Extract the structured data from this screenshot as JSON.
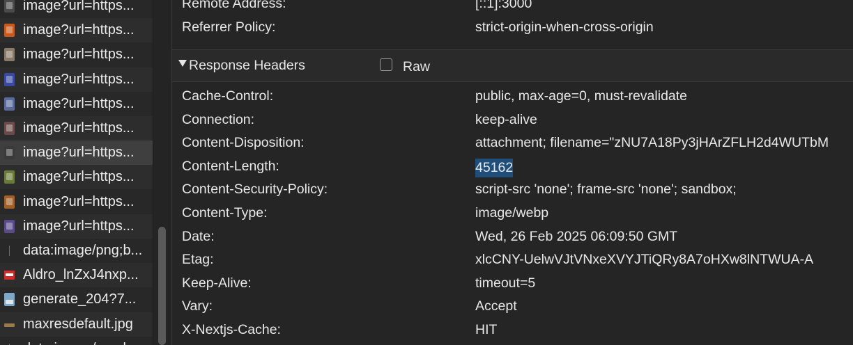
{
  "requests": [
    {
      "label": "image?url=https...",
      "icon": "image-thumbnail-icon",
      "color": "#4a4a4a"
    },
    {
      "label": "image?url=https...",
      "icon": "image-thumbnail-icon",
      "color": "#c85a1e"
    },
    {
      "label": "image?url=https...",
      "icon": "image-thumbnail-icon",
      "color": "#8a7a6a"
    },
    {
      "label": "image?url=https...",
      "icon": "image-thumbnail-icon",
      "color": "#3a4aa0"
    },
    {
      "label": "image?url=https...",
      "icon": "image-thumbnail-icon",
      "color": "#5a6a9a"
    },
    {
      "label": "image?url=https...",
      "icon": "image-thumbnail-icon",
      "color": "#6a4a4a"
    },
    {
      "label": "image?url=https...",
      "icon": "image-thumbnail-icon",
      "color": "#3a3a3a"
    },
    {
      "label": "image?url=https...",
      "icon": "image-thumbnail-icon",
      "color": "#6a7a3a"
    },
    {
      "label": "image?url=https...",
      "icon": "image-thumbnail-icon",
      "color": "#a0602a"
    },
    {
      "label": "image?url=https...",
      "icon": "image-thumbnail-icon",
      "color": "#5a4a8a"
    },
    {
      "label": "data:image/png;b...",
      "icon": "blank-file-icon",
      "color": "#282828"
    },
    {
      "label": "Aldro_lnZxJ4nxp...",
      "icon": "marvel-logo-icon",
      "color": "#d32a2a"
    },
    {
      "label": "generate_204?7...",
      "icon": "generic-image-icon",
      "color": "#7fa8c8"
    },
    {
      "label": "maxresdefault.jpg",
      "icon": "jpg-thumbnail-icon",
      "color": "#282828"
    },
    {
      "label": "data:image/png;b...",
      "icon": "blank-file-icon",
      "color": "#282828"
    }
  ],
  "selected_index": 6,
  "general": {
    "remote_address_key": "Remote Address:",
    "remote_address_val": "[::1]:3000",
    "referrer_key": "Referrer Policy:",
    "referrer_val": "strict-origin-when-cross-origin"
  },
  "response_section": {
    "title": "Response Headers",
    "raw_label": "Raw",
    "raw_checked": false
  },
  "headers": [
    {
      "key": "Cache-Control:",
      "value": "public, max-age=0, must-revalidate"
    },
    {
      "key": "Connection:",
      "value": "keep-alive"
    },
    {
      "key": "Content-Disposition:",
      "value": "attachment; filename=\"zNU7A18Py3jHArZFLH2d4WUTbM"
    },
    {
      "key": "Content-Length:",
      "value": "45162"
    },
    {
      "key": "Content-Security-Policy:",
      "value": "script-src 'none'; frame-src 'none'; sandbox;"
    },
    {
      "key": "Content-Type:",
      "value": "image/webp"
    },
    {
      "key": "Date:",
      "value": "Wed, 26 Feb 2025 06:09:50 GMT"
    },
    {
      "key": "Etag:",
      "value": "xlcCNY-UelwVJtVNxeXVYJTiQRy8A7oHXw8lNTWUA-A"
    },
    {
      "key": "Keep-Alive:",
      "value": "timeout=5"
    },
    {
      "key": "Vary:",
      "value": "Accept"
    },
    {
      "key": "X-Nextjs-Cache:",
      "value": "HIT"
    }
  ],
  "highlighted_header_index": 3
}
